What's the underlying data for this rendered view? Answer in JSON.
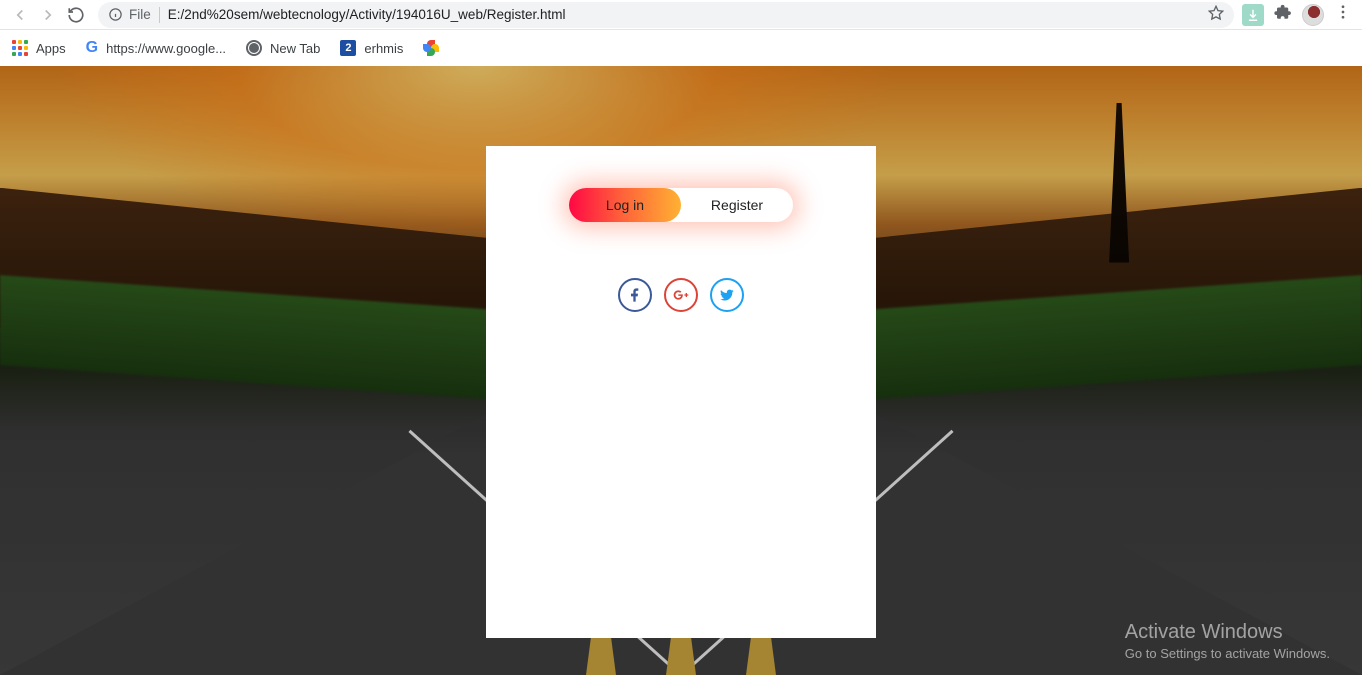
{
  "browser": {
    "url_prefix": "File",
    "url": "E:/2nd%20sem/webtecnology/Activity/194016U_web/Register.html"
  },
  "bookmarks": {
    "apps": "Apps",
    "google": "https://www.google...",
    "newtab": "New Tab",
    "erhmis": "erhmis"
  },
  "auth": {
    "login_label": "Log in",
    "register_label": "Register"
  },
  "watermark": {
    "title": "Activate Windows",
    "subtitle": "Go to Settings to activate Windows."
  }
}
